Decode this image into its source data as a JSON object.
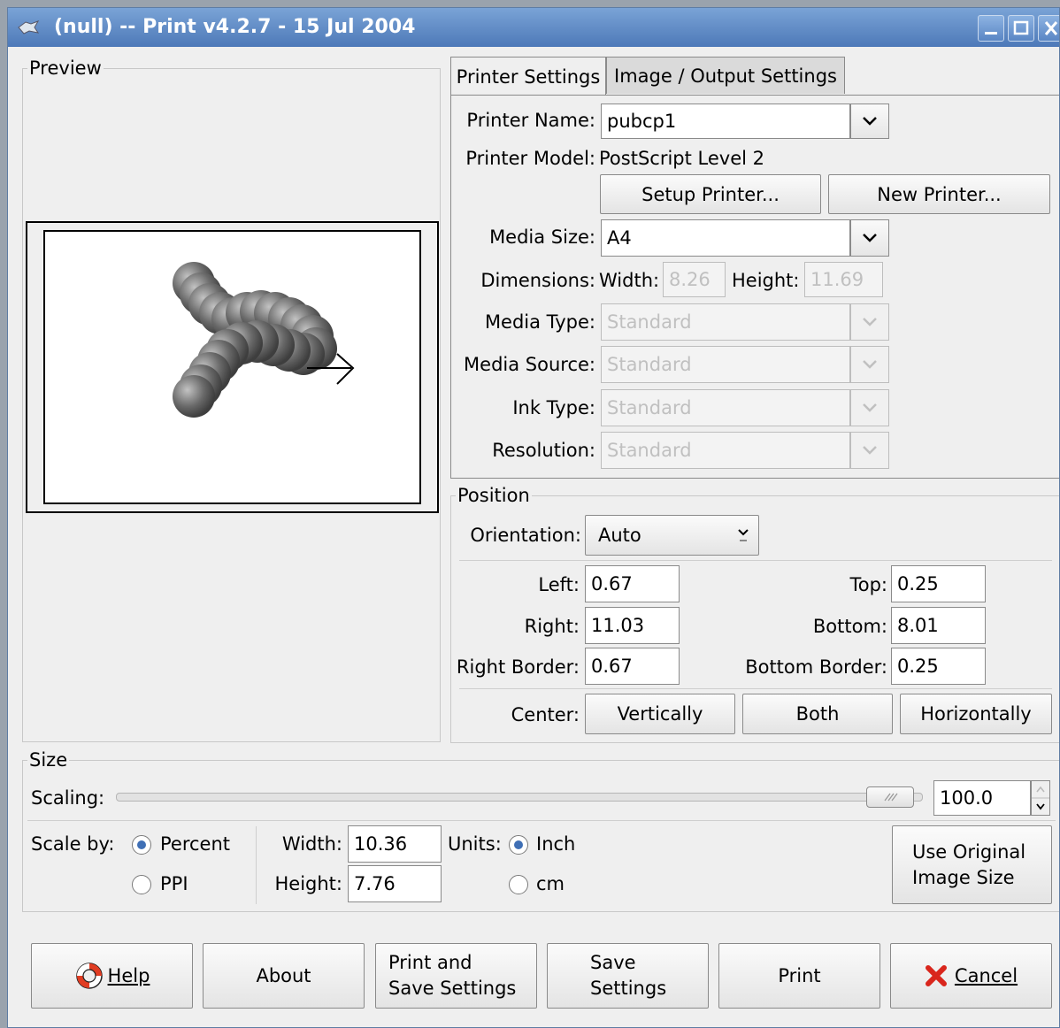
{
  "window": {
    "title": "(null) -- Print v4.2.7 - 15 Jul 2004"
  },
  "preview": {
    "label": "Preview"
  },
  "tabs": {
    "printer_settings": "Printer Settings",
    "image_output_settings": "Image / Output Settings"
  },
  "printer": {
    "name_label": "Printer Name:",
    "name_value": "pubcp1",
    "model_label": "Printer Model:",
    "model_value": "PostScript Level 2",
    "setup_button": "Setup Printer...",
    "new_button": "New Printer...",
    "media_size_label": "Media Size:",
    "media_size_value": "A4",
    "dimensions_label": "Dimensions:",
    "width_label": "Width:",
    "width_value": "8.26",
    "height_label": "Height:",
    "height_value": "11.69",
    "media_type_label": "Media Type:",
    "media_type_value": "Standard",
    "media_source_label": "Media Source:",
    "media_source_value": "Standard",
    "ink_type_label": "Ink Type:",
    "ink_type_value": "Standard",
    "resolution_label": "Resolution:",
    "resolution_value": "Standard"
  },
  "position": {
    "label": "Position",
    "orientation_label": "Orientation:",
    "orientation_value": "Auto",
    "left_label": "Left:",
    "left_value": "0.67",
    "top_label": "Top:",
    "top_value": "0.25",
    "right_label": "Right:",
    "right_value": "11.03",
    "bottom_label": "Bottom:",
    "bottom_value": "8.01",
    "right_border_label": "Right Border:",
    "right_border_value": "0.67",
    "bottom_border_label": "Bottom Border:",
    "bottom_border_value": "0.25",
    "center_label": "Center:",
    "vertically_button": "Vertically",
    "both_button": "Both",
    "horizontally_button": "Horizontally"
  },
  "size": {
    "label": "Size",
    "scaling_label": "Scaling:",
    "scaling_value": "100.0",
    "scaling_fraction": 0.99,
    "scale_by_label": "Scale by:",
    "percent_label": "Percent",
    "ppi_label": "PPI",
    "scale_by_selected": "Percent",
    "width_label": "Width:",
    "width_value": "10.36",
    "height_label": "Height:",
    "height_value": "7.76",
    "units_label": "Units:",
    "inch_label": "Inch",
    "cm_label": "cm",
    "units_selected": "Inch",
    "use_original_line1": "Use Original",
    "use_original_line2": "Image Size"
  },
  "buttons": {
    "help": "Help",
    "about": "About",
    "print_save_line1": "Print and",
    "print_save_line2": "Save Settings",
    "save_line1": "Save",
    "save_line2": "Settings",
    "print": "Print",
    "cancel": "Cancel"
  },
  "icons": {
    "help": "lifebuoy-icon",
    "cancel": "red-x-icon",
    "app": "gimp-icon"
  }
}
